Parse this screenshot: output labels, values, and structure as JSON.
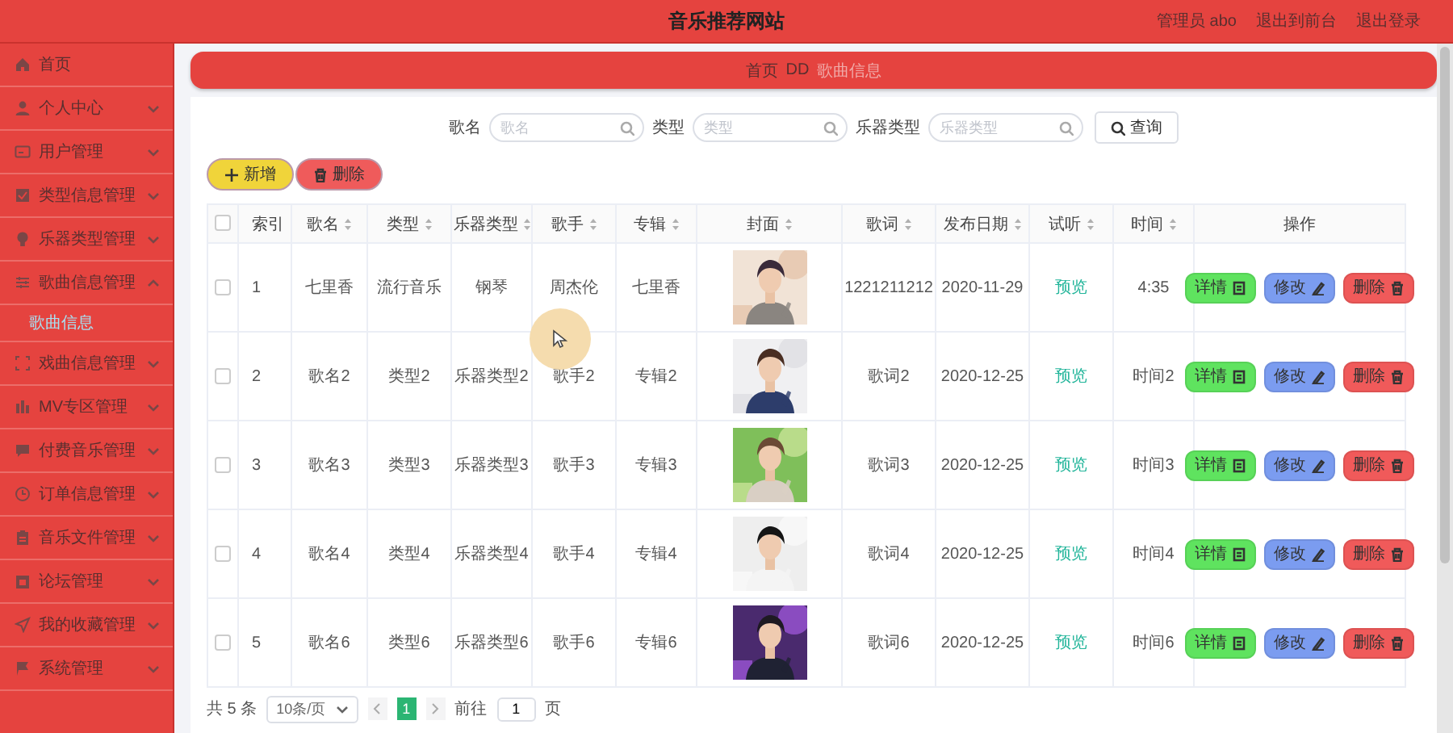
{
  "header": {
    "title": "音乐推荐网站",
    "links": [
      "管理员 abo",
      "退出到前台",
      "退出登录"
    ]
  },
  "sidebar": {
    "items": [
      {
        "label": "首页"
      },
      {
        "label": "个人中心",
        "expanded": false
      },
      {
        "label": "用户管理",
        "expanded": false
      },
      {
        "label": "类型信息管理",
        "expanded": false
      },
      {
        "label": "乐器类型管理",
        "expanded": false
      },
      {
        "label": "歌曲信息管理",
        "expanded": true,
        "children": [
          {
            "label": "歌曲信息",
            "selected": true
          }
        ]
      },
      {
        "label": "戏曲信息管理",
        "expanded": false
      },
      {
        "label": "MV专区管理",
        "expanded": false
      },
      {
        "label": "付费音乐管理",
        "expanded": false
      },
      {
        "label": "订单信息管理",
        "expanded": false
      },
      {
        "label": "音乐文件管理",
        "expanded": false
      },
      {
        "label": "论坛管理",
        "expanded": false
      },
      {
        "label": "我的收藏管理",
        "expanded": false
      },
      {
        "label": "系统管理",
        "expanded": false
      }
    ]
  },
  "breadcrumb": {
    "separator": "DD",
    "items": [
      {
        "label": "首页",
        "selected": false
      },
      {
        "label": "歌曲信息",
        "selected": true
      }
    ]
  },
  "search": {
    "fields": [
      {
        "label": "歌名",
        "placeholder": "歌名"
      },
      {
        "label": "类型",
        "placeholder": "类型"
      },
      {
        "label": "乐器类型",
        "placeholder": "乐器类型"
      }
    ],
    "button": "查询"
  },
  "actions": [
    {
      "kind": "add",
      "label": "新增"
    },
    {
      "kind": "delete",
      "label": "删除"
    }
  ],
  "table": {
    "all_checked": false,
    "columns": [
      {
        "label": "索引",
        "sortable": false
      },
      {
        "label": "歌名",
        "sortable": true
      },
      {
        "label": "类型",
        "sortable": true
      },
      {
        "label": "乐器类型",
        "sortable": true
      },
      {
        "label": "歌手",
        "sortable": true
      },
      {
        "label": "专辑",
        "sortable": true
      },
      {
        "label": "封面",
        "sortable": true
      },
      {
        "label": "歌词",
        "sortable": true
      },
      {
        "label": "发布日期",
        "sortable": true
      },
      {
        "label": "试听",
        "sortable": true
      },
      {
        "label": "时间",
        "sortable": true
      },
      {
        "label": "操作",
        "sortable": false
      }
    ],
    "rows": [
      {
        "checked": false,
        "index": "1",
        "name": "七里香",
        "type": "流行音乐",
        "instrument": "钢琴",
        "singer": "周杰伦",
        "album": "七里香",
        "lyrics": "1221211212",
        "date": "2020-11-29",
        "preview": "预览",
        "time": "4:35",
        "actions": [
          {
            "kind": "detail",
            "label": "详情"
          },
          {
            "kind": "edit",
            "label": "修改"
          },
          {
            "kind": "delete",
            "label": "删除"
          }
        ]
      },
      {
        "checked": false,
        "index": "2",
        "name": "歌名2",
        "type": "类型2",
        "instrument": "乐器类型2",
        "singer": "歌手2",
        "album": "专辑2",
        "lyrics": "歌词2",
        "date": "2020-12-25",
        "preview": "预览",
        "time": "时间2",
        "actions": [
          {
            "kind": "detail",
            "label": "详情"
          },
          {
            "kind": "edit",
            "label": "修改"
          },
          {
            "kind": "delete",
            "label": "删除"
          }
        ]
      },
      {
        "checked": false,
        "index": "3",
        "name": "歌名3",
        "type": "类型3",
        "instrument": "乐器类型3",
        "singer": "歌手3",
        "album": "专辑3",
        "lyrics": "歌词3",
        "date": "2020-12-25",
        "preview": "预览",
        "time": "时间3",
        "actions": [
          {
            "kind": "detail",
            "label": "详情"
          },
          {
            "kind": "edit",
            "label": "修改"
          },
          {
            "kind": "delete",
            "label": "删除"
          }
        ]
      },
      {
        "checked": false,
        "index": "4",
        "name": "歌名4",
        "type": "类型4",
        "instrument": "乐器类型4",
        "singer": "歌手4",
        "album": "专辑4",
        "lyrics": "歌词4",
        "date": "2020-12-25",
        "preview": "预览",
        "time": "时间4",
        "actions": [
          {
            "kind": "detail",
            "label": "详情"
          },
          {
            "kind": "edit",
            "label": "修改"
          },
          {
            "kind": "delete",
            "label": "删除"
          }
        ]
      },
      {
        "checked": false,
        "index": "5",
        "name": "歌名6",
        "type": "类型6",
        "instrument": "乐器类型6",
        "singer": "歌手6",
        "album": "专辑6",
        "lyrics": "歌词6",
        "date": "2020-12-25",
        "preview": "预览",
        "time": "时间6",
        "actions": [
          {
            "kind": "detail",
            "label": "详情"
          },
          {
            "kind": "edit",
            "label": "修改"
          },
          {
            "kind": "delete",
            "label": "删除"
          }
        ]
      }
    ]
  },
  "pagination": {
    "total": "共 5 条",
    "page_size": "10条/页",
    "pages": [
      {
        "label": "1",
        "selected": true
      }
    ],
    "goto_label": "前往",
    "goto_value": "1",
    "goto_suffix": "页"
  }
}
